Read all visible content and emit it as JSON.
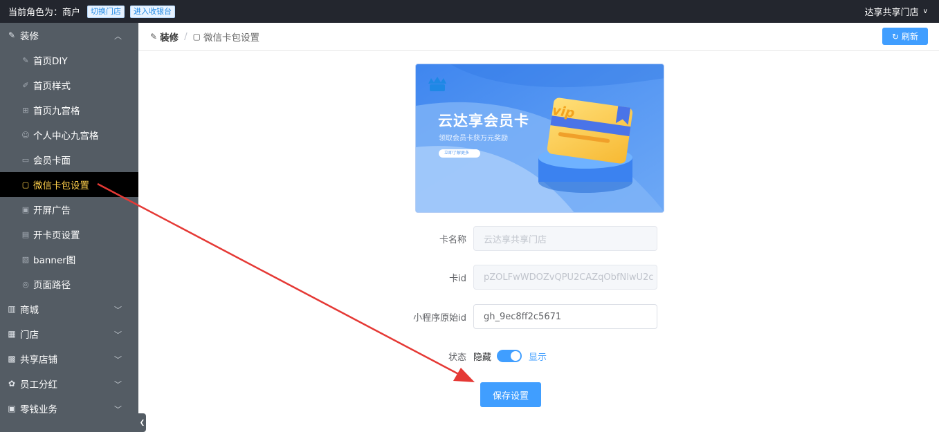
{
  "topbar": {
    "role_text": "当前角色为：商户",
    "switch_store_label": "切换门店",
    "cashier_label": "进入收银台",
    "store_name": "达享共享门店"
  },
  "sidebar": {
    "groups": [
      {
        "label": "装修",
        "icon": "brush-icon",
        "expanded": true
      },
      {
        "label": "商城",
        "icon": "shop-icon"
      },
      {
        "label": "门店",
        "icon": "store-icon"
      },
      {
        "label": "共享店铺",
        "icon": "shared-store-icon"
      },
      {
        "label": "员工分红",
        "icon": "staff-icon"
      },
      {
        "label": "零钱业务",
        "icon": "wallet-icon"
      }
    ],
    "sub_items": [
      {
        "label": "首页DIY",
        "icon": "edit-icon"
      },
      {
        "label": "首页样式",
        "icon": "brush-icon"
      },
      {
        "label": "首页九宫格",
        "icon": "grid-icon"
      },
      {
        "label": "个人中心九宫格",
        "icon": "user-icon"
      },
      {
        "label": "会员卡面",
        "icon": "card-icon"
      },
      {
        "label": "微信卡包设置",
        "icon": "wallet-icon",
        "active": true
      },
      {
        "label": "开屏广告",
        "icon": "ad-icon"
      },
      {
        "label": "开卡页设置",
        "icon": "page-icon"
      },
      {
        "label": "banner图",
        "icon": "image-icon"
      },
      {
        "label": "页面路径",
        "icon": "path-icon"
      }
    ]
  },
  "header": {
    "crumb_parent": "装修",
    "crumb_current": "微信卡包设置",
    "refresh_label": "刷新"
  },
  "banner": {
    "title": "云达享会员卡",
    "subtitle": "领取会员卡获万元奖励",
    "button": "立即了解更多",
    "card_text": "vip"
  },
  "form": {
    "card_name": {
      "label": "卡名称",
      "placeholder": "云达享共享门店"
    },
    "card_id": {
      "label": "卡id",
      "placeholder": "pZOLFwWDOZvQPU2CAZqObfNlwU2c"
    },
    "mini_id": {
      "label": "小程序原始id",
      "value": "gh_9ec8ff2c5671"
    },
    "status": {
      "label": "状态",
      "off_label": "隐藏",
      "on_label": "显示",
      "checked": true
    },
    "save_label": "保存设置"
  },
  "colors": {
    "primary": "#409eff",
    "sidebar_bg": "#545c64",
    "topbar_bg": "#23262e",
    "active_text": "#ffd04b",
    "annotation_arrow": "#e53935"
  }
}
